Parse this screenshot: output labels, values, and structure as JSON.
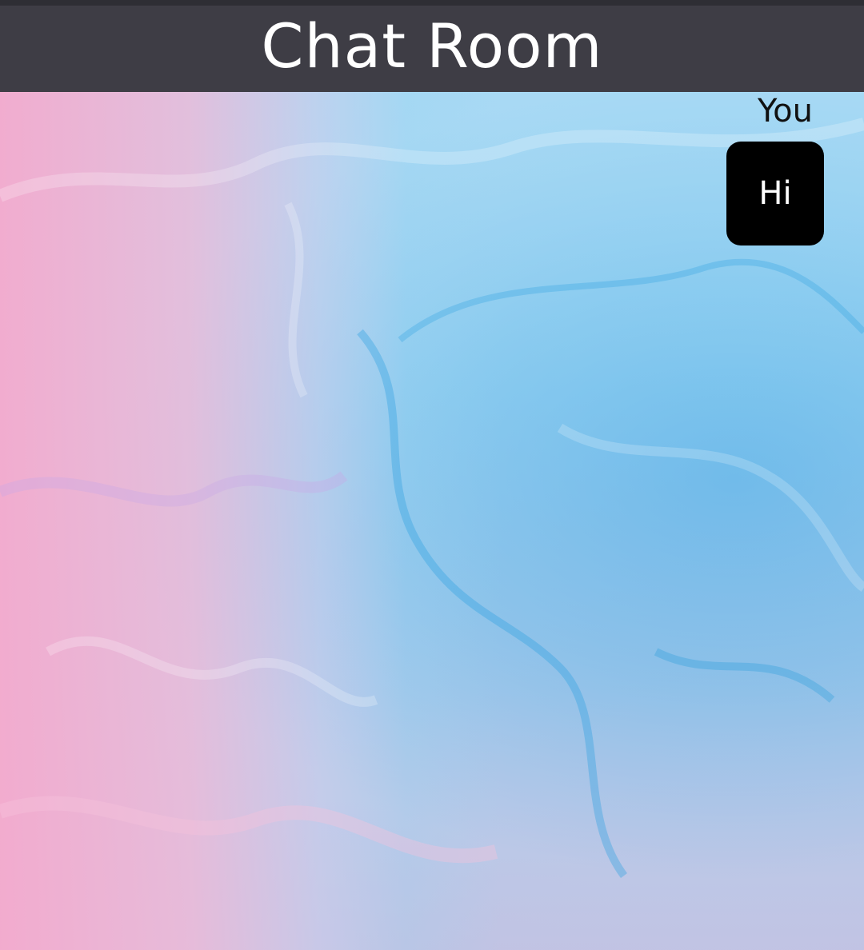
{
  "header": {
    "title": "Chat Room"
  },
  "chat": {
    "messages": [
      {
        "sender": "You",
        "text": "Hi"
      }
    ]
  },
  "colors": {
    "header_bg": "#3e3d45",
    "bubble_bg": "#000000",
    "bubble_text": "#ffffff",
    "background_pink": "#f4aacb",
    "background_blue": "#48b3ea"
  },
  "background": {
    "description_icon": "marble-wallpaper-image"
  }
}
